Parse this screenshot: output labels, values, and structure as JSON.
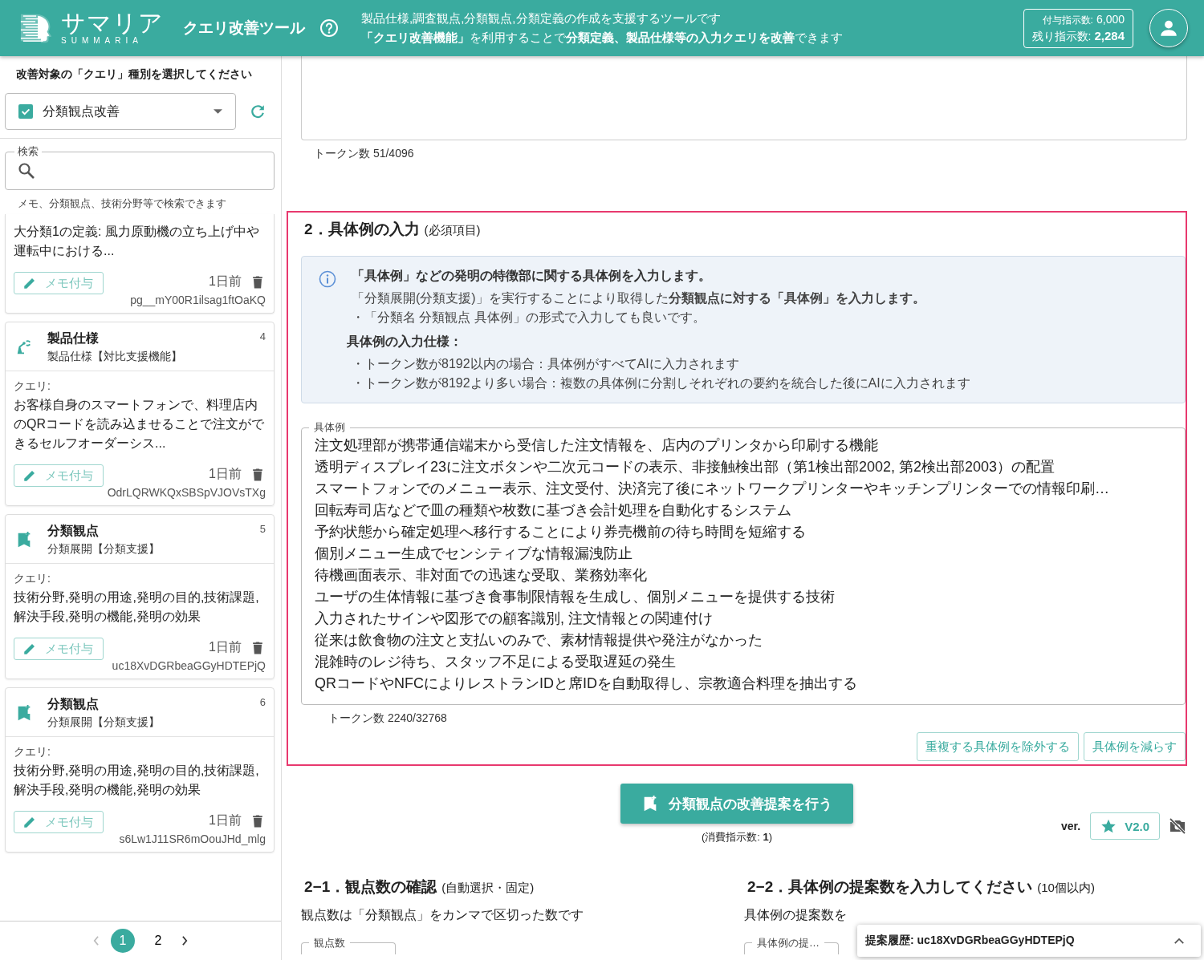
{
  "header": {
    "logo": {
      "name": "サマリア",
      "sub": "SUMMARIA"
    },
    "title": "クエリ改善ツール",
    "description": [
      "製品仕様,調査観点,分類観点,分類定義の作成を支援するツールです",
      "**「クエリ改善機能」**を利用することで**分類定義、製品仕様等の入力クエリを改善**できます"
    ],
    "quota": {
      "granted_label": "付与指示数:",
      "granted": "6,000",
      "remaining_label": "残り指示数:",
      "remaining": "2,284"
    }
  },
  "sidebar": {
    "prompt": "改善対象の「クエリ」種別を選択してください",
    "select": {
      "value": "分類観点改善",
      "checked": true
    },
    "search": {
      "label": "検索",
      "hint": "メモ、分類観点、技術分野等で検索できます"
    },
    "cards": [
      {
        "kind": "cut",
        "query": "大分類1の定義: 風力原動機の立ち上げ中や運転中における...",
        "memo_button": "メモ付与",
        "time": "1日前",
        "id": "pg__mY00R1ilsag1ftOaKQ"
      },
      {
        "kind": "product",
        "title": "製品仕様",
        "subtitle": "製品仕様【対比支援機能】",
        "number": "4",
        "query_label": "クエリ:",
        "query": "お客様自身のスマートフォンで、料理店内のQRコードを読み込ませることで注文ができるセルフオーダーシス...",
        "memo_button": "メモ付与",
        "time": "1日前",
        "id": "OdrLQRWKQxSBSpVJOVsTXg"
      },
      {
        "kind": "viewpoint",
        "title": "分類観点",
        "subtitle": "分類展開【分類支援】",
        "number": "5",
        "query_label": "クエリ:",
        "query": "技術分野,発明の用途,発明の目的,技術課題,解決手段,発明の機能,発明の効果",
        "memo_button": "メモ付与",
        "time": "1日前",
        "id": "uc18XvDGRbeaGGyHDTEPjQ"
      },
      {
        "kind": "viewpoint",
        "title": "分類観点",
        "subtitle": "分類展開【分類支援】",
        "number": "6",
        "query_label": "クエリ:",
        "query": "技術分野,発明の用途,発明の目的,技術課題,解決手段,発明の機能,発明の効果",
        "memo_button": "メモ付与",
        "time": "1日前",
        "id": "s6Lw1J11SR6mOouJHd_mlg"
      }
    ],
    "pagination": [
      {
        "label": "1",
        "selected": true
      },
      {
        "label": "2",
        "selected": false
      }
    ]
  },
  "main": {
    "previous_token_count": "トークン数 51/4096",
    "section": {
      "highlighted": true,
      "heading": "2．具体例の入力",
      "note": "(必須項目)",
      "info": {
        "title": "「具体例」などの発明の特徴部に関する具体例を入力します。",
        "lines": [
          "「分類展開(分類支援)」を実行することにより取得した**分類観点に対する「具体例」を入力します。**",
          "・「分類名 分類観点 具体例」の形式で入力しても良いです。"
        ],
        "spec_heading": "具体例の入力仕様：",
        "spec_items": [
          "・トークン数が8192以内の場合：具体例がすべてAIに入力されます",
          "・トークン数が8192より多い場合：複数の具体例に分割しそれぞれの要約を統合した後にAIに入力されます"
        ]
      },
      "field_label": "具体例",
      "examples": [
        "注文処理部が携帯通信端末から受信した注文情報を、店内のプリンタから印刷する機能",
        "透明ディスプレイ23に注文ボタンや二次元コードの表示、非接触検出部（第1検出部2002, 第2検出部2003）の配置",
        "スマートフォンでのメニュー表示、注文受付、決済完了後にネットワークプリンターやキッチンプリンターでの情報印刷…",
        "回転寿司店などで皿の種類や枚数に基づき会計処理を自動化するシステム",
        "予約状態から確定処理へ移行することにより券売機前の待ち時間を短縮する",
        "個別メニュー生成でセンシティブな情報漏洩防止",
        "待機画面表示、非対面での迅速な受取、業務効率化",
        "ユーザの生体情報に基づき食事制限情報を生成し、個別メニューを提供する技術",
        "入力されたサインや図形での顧客識別, 注文情報との関連付け",
        "従来は飲食物の注文と支払いのみで、素材情報提供や発注がなかった",
        "混雑時のレジ待ち、スタッフ不足による受取遅延の発生",
        "QRコードやNFCによりレストランIDと席IDを自動取得し、宗教適合料理を抽出する"
      ],
      "token_count": "トークン数 2240/32768",
      "buttons": [
        "重複する具体例を除外する",
        "具体例を減らす"
      ]
    },
    "submit": {
      "label": "分類観点の改善提案を行う",
      "cost": "(消費指示数: **1**)"
    },
    "version": {
      "label": "ver.",
      "value": "V2.0"
    },
    "subsections": [
      {
        "heading": "2−1．観点数の確認",
        "note": "(自動選択・固定)",
        "description": "観点数は「分類観点」をカンマで区切った数です",
        "field_label": "観点数"
      },
      {
        "heading": "2−2．具体例の提案数を入力してください",
        "note": "(10個以内)",
        "description": "具体例の提案数を",
        "field_label": "具体例の提…"
      }
    ],
    "history": {
      "label": "提案履歴: uc18XvDGRbeaGGyHDTEPjQ"
    }
  }
}
